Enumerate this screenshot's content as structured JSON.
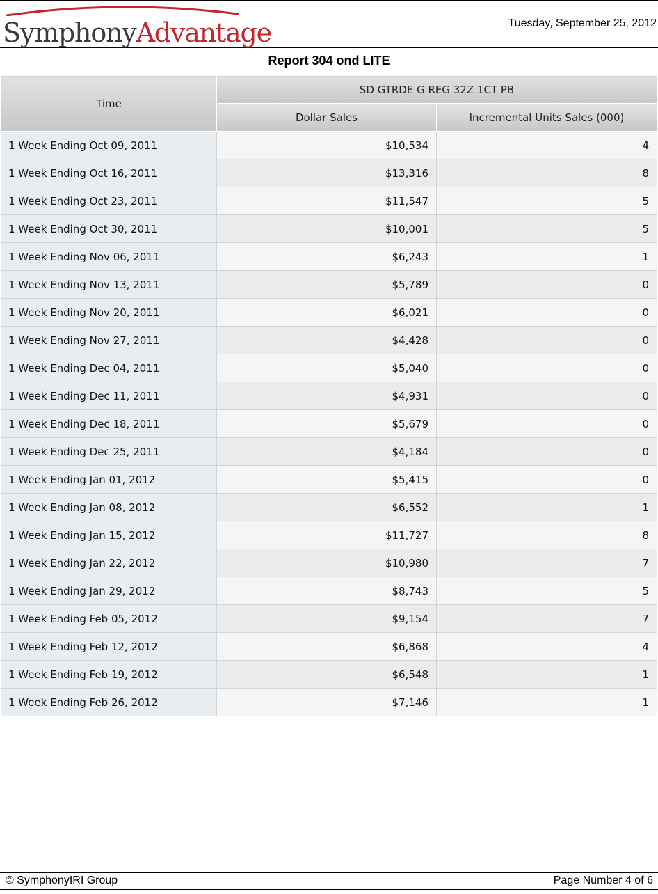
{
  "header": {
    "logo": {
      "part1": "Symphony",
      "part2": "Advantage",
      "arc_color": "#c1272d"
    },
    "date": "Tuesday, September 25, 2012"
  },
  "report": {
    "title": "Report 304 ond LITE"
  },
  "table": {
    "time_header": "Time",
    "group_header": "SD GTRDE G REG 32Z 1CT PB",
    "columns": [
      "Dollar Sales",
      "Incremental Units Sales (000)"
    ],
    "rows": [
      {
        "time": "1 Week Ending Oct 09, 2011",
        "dollar_sales": "$10,534",
        "incremental_units": "4"
      },
      {
        "time": "1 Week Ending Oct 16, 2011",
        "dollar_sales": "$13,316",
        "incremental_units": "8"
      },
      {
        "time": "1 Week Ending Oct 23, 2011",
        "dollar_sales": "$11,547",
        "incremental_units": "5"
      },
      {
        "time": "1 Week Ending Oct 30, 2011",
        "dollar_sales": "$10,001",
        "incremental_units": "5"
      },
      {
        "time": "1 Week Ending Nov 06, 2011",
        "dollar_sales": "$6,243",
        "incremental_units": "1"
      },
      {
        "time": "1 Week Ending Nov 13, 2011",
        "dollar_sales": "$5,789",
        "incremental_units": "0"
      },
      {
        "time": "1 Week Ending Nov 20, 2011",
        "dollar_sales": "$6,021",
        "incremental_units": "0"
      },
      {
        "time": "1 Week Ending Nov 27, 2011",
        "dollar_sales": "$4,428",
        "incremental_units": "0"
      },
      {
        "time": "1 Week Ending Dec 04, 2011",
        "dollar_sales": "$5,040",
        "incremental_units": "0"
      },
      {
        "time": "1 Week Ending Dec 11, 2011",
        "dollar_sales": "$4,931",
        "incremental_units": "0"
      },
      {
        "time": "1 Week Ending Dec 18, 2011",
        "dollar_sales": "$5,679",
        "incremental_units": "0"
      },
      {
        "time": "1 Week Ending Dec 25, 2011",
        "dollar_sales": "$4,184",
        "incremental_units": "0"
      },
      {
        "time": "1 Week Ending Jan 01, 2012",
        "dollar_sales": "$5,415",
        "incremental_units": "0"
      },
      {
        "time": "1 Week Ending Jan 08, 2012",
        "dollar_sales": "$6,552",
        "incremental_units": "1"
      },
      {
        "time": "1 Week Ending Jan 15, 2012",
        "dollar_sales": "$11,727",
        "incremental_units": "8"
      },
      {
        "time": "1 Week Ending Jan 22, 2012",
        "dollar_sales": "$10,980",
        "incremental_units": "7"
      },
      {
        "time": "1 Week Ending Jan 29, 2012",
        "dollar_sales": "$8,743",
        "incremental_units": "5"
      },
      {
        "time": "1 Week Ending Feb 05, 2012",
        "dollar_sales": "$9,154",
        "incremental_units": "7"
      },
      {
        "time": "1 Week Ending Feb 12, 2012",
        "dollar_sales": "$6,868",
        "incremental_units": "4"
      },
      {
        "time": "1 Week Ending Feb 19, 2012",
        "dollar_sales": "$6,548",
        "incremental_units": "1"
      },
      {
        "time": "1 Week Ending Feb 26, 2012",
        "dollar_sales": "$7,146",
        "incremental_units": "1"
      }
    ]
  },
  "footer": {
    "copyright": "© SymphonyIRI Group",
    "page_number": "Page Number 4 of 6"
  }
}
